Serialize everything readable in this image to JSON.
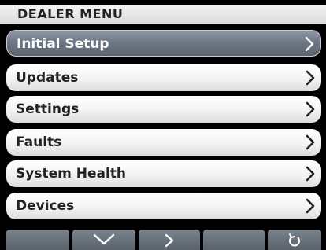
{
  "header": {
    "title": "DEALER MENU"
  },
  "menu": {
    "selected_index": 0,
    "items": [
      {
        "label": "Initial Setup",
        "icon": "chevron-right-icon"
      },
      {
        "label": "Updates",
        "icon": "chevron-right-icon"
      },
      {
        "label": "Settings",
        "icon": "chevron-right-icon"
      },
      {
        "label": "Faults",
        "icon": "chevron-right-icon"
      },
      {
        "label": "System Health",
        "icon": "chevron-right-icon"
      },
      {
        "label": "Devices",
        "icon": "chevron-right-icon"
      }
    ]
  },
  "softkeys": [
    {
      "name": "softkey-1",
      "icon": ""
    },
    {
      "name": "softkey-down",
      "icon": "chevron-down-icon"
    },
    {
      "name": "softkey-right",
      "icon": "chevron-right-icon"
    },
    {
      "name": "softkey-4",
      "icon": ""
    },
    {
      "name": "softkey-back",
      "icon": "back-arrow-icon"
    }
  ],
  "colors": {
    "background": "#000000",
    "title_bar": "#e8e8e8",
    "item_bg": "#f3f3f3",
    "selected_item_bg": "#6f7884",
    "softkey_bg": "#6b737c"
  }
}
